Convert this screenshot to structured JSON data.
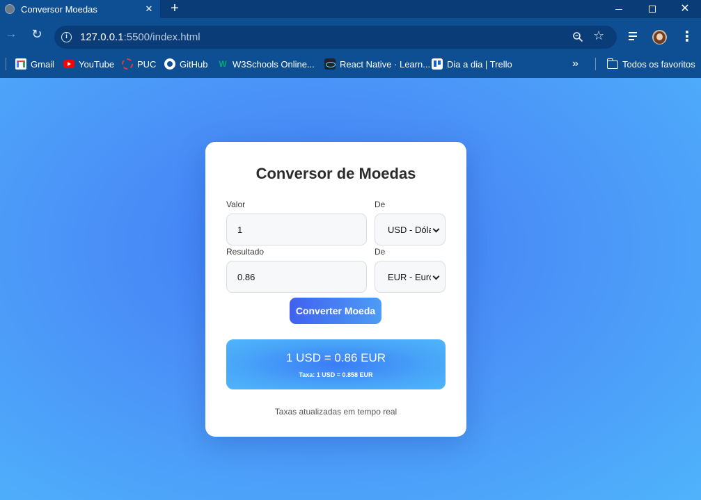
{
  "browser": {
    "tab_title": "Conversor Moedas",
    "url_host": "127.0.0.1",
    "url_rest": ":5500/index.html",
    "bookmarks": [
      {
        "label": "Gmail",
        "icon": "gmail-icon"
      },
      {
        "label": "YouTube",
        "icon": "youtube-icon"
      },
      {
        "label": "PUC",
        "icon": "puc-icon"
      },
      {
        "label": "GitHub",
        "icon": "github-icon"
      },
      {
        "label": "W3Schools Online...",
        "icon": "w3schools-icon"
      },
      {
        "label": "React Native · Learn...",
        "icon": "react-icon"
      },
      {
        "label": "Dia a dia | Trello",
        "icon": "trello-icon"
      }
    ],
    "all_bookmarks_label": "Todos os favoritos"
  },
  "converter": {
    "title": "Conversor de Moedas",
    "value_label": "Valor",
    "value": "1",
    "from_label": "De",
    "from_currency": "USD - Dólar",
    "result_label": "Resultado",
    "result_value": "0.86",
    "to_label": "De",
    "to_currency": "EUR - Euro",
    "button_label": "Converter Moeda",
    "result_main": "1 USD = 0.86 EUR",
    "result_rate": "Taxa: 1 USD = 0.858 EUR",
    "footnote": "Taxas atualizadas em tempo real"
  },
  "colors": {
    "browser_frame": "#0e4f93",
    "page_bg": "#4a90f7",
    "accent": "#3f62f0"
  }
}
